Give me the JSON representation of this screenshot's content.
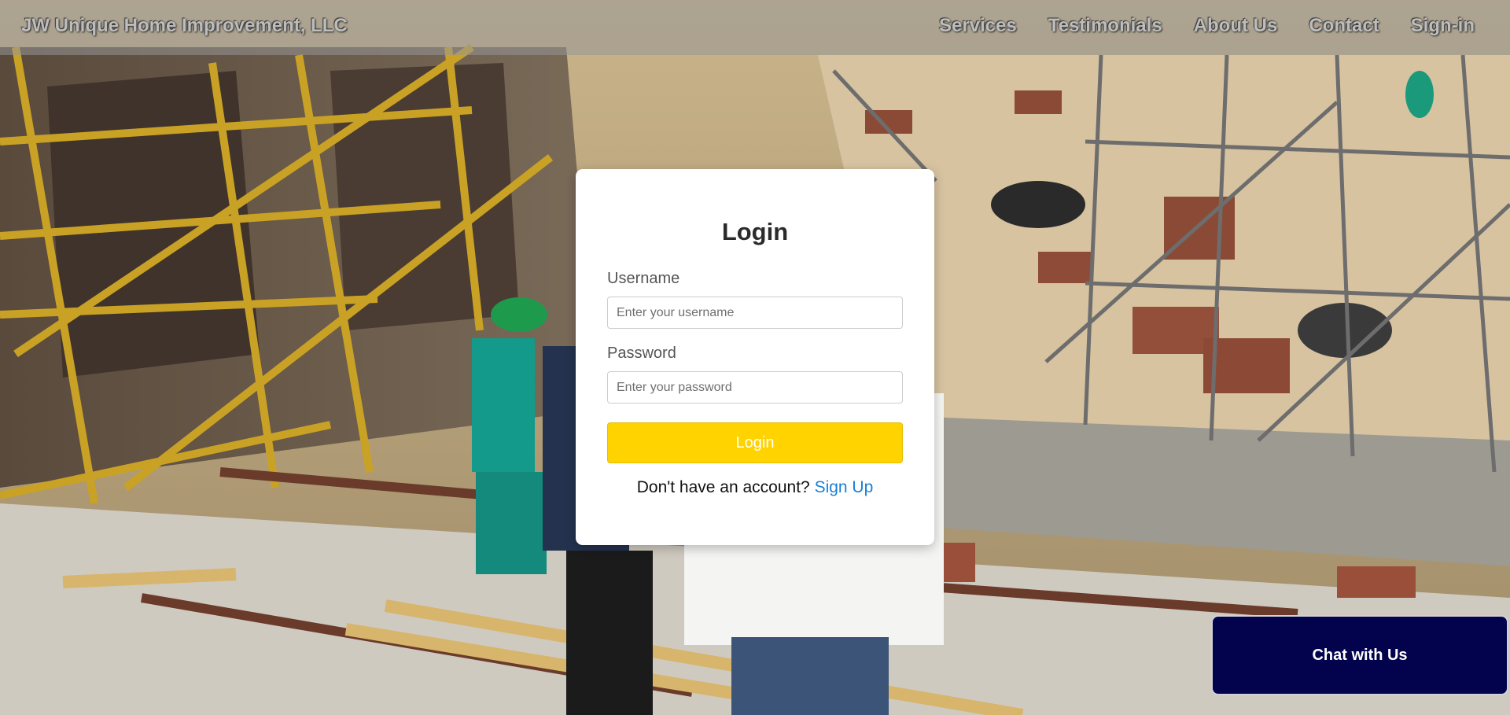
{
  "header": {
    "brand": "JW Unique Home Improvement, LLC",
    "nav": [
      "Services",
      "Testimonials",
      "About Us",
      "Contact",
      "Sign-in"
    ]
  },
  "login": {
    "title": "Login",
    "username_label": "Username",
    "username_placeholder": "Enter your username",
    "username_value": "",
    "password_label": "Password",
    "password_placeholder": "Enter your password",
    "password_value": "",
    "button_label": "Login",
    "signup_prompt": "Don't have an account?",
    "signup_link": "Sign Up"
  },
  "chat": {
    "label": "Chat with Us"
  },
  "colors": {
    "login_button": "#ffd300",
    "chat_button": "#03024d",
    "signup_link": "#1a7fd6"
  }
}
